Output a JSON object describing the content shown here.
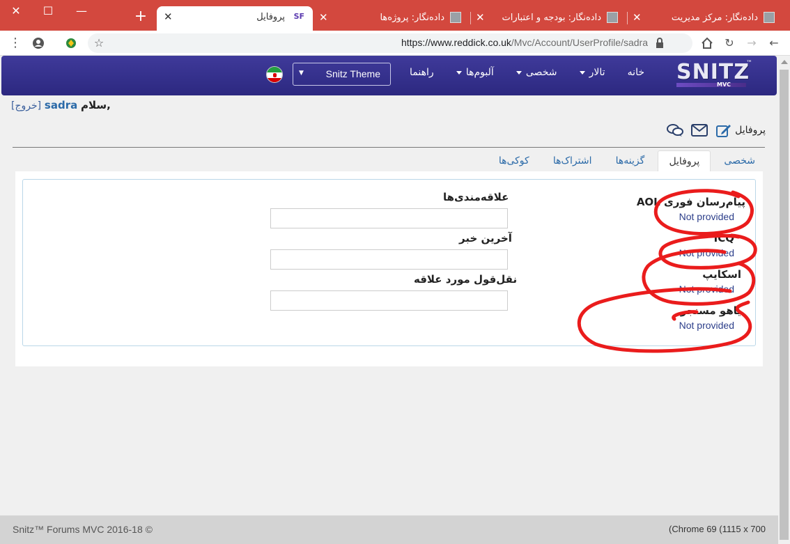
{
  "browser": {
    "tabs": [
      {
        "title": "داده‌نگار: مرکز مدیریت",
        "active": false
      },
      {
        "title": "داده‌نگار: بودجه و اعتبارات",
        "active": false
      },
      {
        "title": "داده‌نگار: پروژه‌ها",
        "active": false
      },
      {
        "title": "پروفایل",
        "active": true,
        "favicon": "SF"
      }
    ],
    "url_host": "https://www.reddick.co.uk",
    "url_path": "/Mvc/Account/UserProfile/sadra"
  },
  "navbar": {
    "logo_text": "SNITZ",
    "logo_tm": "™",
    "logo_sub": "MVC",
    "items": [
      {
        "label": "خانه",
        "dropdown": false
      },
      {
        "label": "تالار",
        "dropdown": true
      },
      {
        "label": "شخصی",
        "dropdown": true
      },
      {
        "label": "آلبوم‌ها",
        "dropdown": true
      },
      {
        "label": "راهنما",
        "dropdown": false
      }
    ],
    "theme_select": "Snitz Theme",
    "flag_icon": "iran-flag-icon"
  },
  "greeting": {
    "logout": "[خروج]",
    "username": "sadra",
    "hello": "سلام,"
  },
  "profile_header": {
    "title": "پروفایل",
    "icons": [
      "edit-icon",
      "mail-icon",
      "chat-icon"
    ]
  },
  "tabs": [
    "شخصی",
    "پروفایل",
    "گزینه‌ها",
    "اشتراک‌ها",
    "کوکی‌ها"
  ],
  "active_tab": "پروفایل",
  "fields_right": [
    {
      "label": "پیام‌رسان فوری AOL",
      "value": "Not provided"
    },
    {
      "label": "ICQ",
      "value": "Not provided"
    },
    {
      "label": "اسکایپ",
      "value": "Not provided"
    },
    {
      "label": "یاهو مسنجر",
      "value": "Not provided"
    }
  ],
  "fields_left": [
    {
      "label": "علاقه‌مندی‌ها",
      "value": ""
    },
    {
      "label": "آخرین خبر",
      "value": ""
    },
    {
      "label": "نقل‌قول مورد علاقه",
      "value": ""
    }
  ],
  "footer": {
    "copyright": "Snitz™ Forums MVC 2016-18 ©",
    "screen_info": "(Chrome 69 (1115 x 700"
  }
}
